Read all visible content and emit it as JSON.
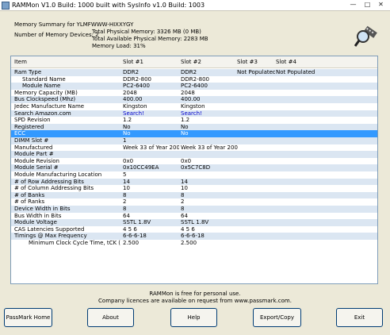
{
  "window": {
    "title": "RAMMon V1.0 Build: 1000 built with SysInfo v1.0 Build: 1003"
  },
  "summary": {
    "title": "Memory Summary for YLMFWWW-HIXXYGY",
    "devices": "Number of Memory Devices: 2",
    "total_physical": "Total Physical Memory: 3326 MB (0 MB)",
    "available_physical": "Total Available Physical Memory: 2283 MB",
    "memory_load": "Memory Load: 31%"
  },
  "table": {
    "headers": [
      "Item",
      "Slot #1",
      "Slot #2",
      "Slot #3",
      "Slot #4"
    ],
    "rows": [
      {
        "item": "Ram Type",
        "s1": "DDR2",
        "s2": "DDR2",
        "s3": "Not Populated",
        "s4": "Not Populated"
      },
      {
        "item": "Standard Name",
        "s1": "DDR2-800",
        "s2": "DDR2-800",
        "s3": "",
        "s4": ""
      },
      {
        "item": "Module Name",
        "s1": "PC2-6400",
        "s2": "PC2-6400",
        "s3": "",
        "s4": ""
      },
      {
        "item": "Memory Capacity (MB)",
        "s1": "2048",
        "s2": "2048",
        "s3": "",
        "s4": ""
      },
      {
        "item": "Bus Clockspeed (Mhz)",
        "s1": "400.00",
        "s2": "400.00",
        "s3": "",
        "s4": ""
      },
      {
        "item": "Jedec Manufacture Name",
        "s1": "Kingston",
        "s2": "Kingston",
        "s3": "",
        "s4": ""
      },
      {
        "item": "Search Amazon.com",
        "s1": "Search!",
        "s2": "Search!",
        "s3": "",
        "s4": ""
      },
      {
        "item": "SPD Revision",
        "s1": "1.2",
        "s2": "1.2",
        "s3": "",
        "s4": ""
      },
      {
        "item": "Registered",
        "s1": "No",
        "s2": "No",
        "s3": "",
        "s4": ""
      },
      {
        "item": "ECC",
        "s1": "No",
        "s2": "No",
        "s3": "",
        "s4": ""
      },
      {
        "item": "DIMM Slot #",
        "s1": "1",
        "s2": "",
        "s3": "",
        "s4": ""
      },
      {
        "item": "Manufactured",
        "s1": "Week 33 of Year 2008",
        "s2": "Week 33 of Year 2008",
        "s3": "",
        "s4": ""
      },
      {
        "item": "Module Part #",
        "s1": "",
        "s2": "",
        "s3": "",
        "s4": ""
      },
      {
        "item": "Module Revision",
        "s1": "0x0",
        "s2": "0x0",
        "s3": "",
        "s4": ""
      },
      {
        "item": "Module Serial #",
        "s1": "0x10CC49EA",
        "s2": "0x5C7C8D",
        "s3": "",
        "s4": ""
      },
      {
        "item": "Module Manufacturing Location",
        "s1": "5",
        "s2": "",
        "s3": "",
        "s4": ""
      },
      {
        "item": "# of Row Addressing Bits",
        "s1": "14",
        "s2": "14",
        "s3": "",
        "s4": ""
      },
      {
        "item": "# of Column Addressing Bits",
        "s1": "10",
        "s2": "10",
        "s3": "",
        "s4": ""
      },
      {
        "item": "# of Banks",
        "s1": "8",
        "s2": "8",
        "s3": "",
        "s4": ""
      },
      {
        "item": "# of Ranks",
        "s1": "2",
        "s2": "2",
        "s3": "",
        "s4": ""
      },
      {
        "item": "Device Width in Bits",
        "s1": "8",
        "s2": "8",
        "s3": "",
        "s4": ""
      },
      {
        "item": "Bus Width in Bits",
        "s1": "64",
        "s2": "64",
        "s3": "",
        "s4": ""
      },
      {
        "item": "Module Voltage",
        "s1": "SSTL 1.8V",
        "s2": "SSTL 1.8V",
        "s3": "",
        "s4": ""
      },
      {
        "item": "CAS Latencies Supported",
        "s1": "4 5 6",
        "s2": "4 5 6",
        "s3": "",
        "s4": ""
      },
      {
        "item": "Timings @ Max Frequency",
        "s1": "6-6-6-18",
        "s2": "6-6-6-18",
        "s3": "",
        "s4": ""
      },
      {
        "item": "Minimum Clock Cycle Time, tCK (ns)",
        "s1": "2.500",
        "s2": "2.500",
        "s3": "",
        "s4": ""
      }
    ]
  },
  "footer": {
    "line1": "RAMMon is free for personal use.",
    "line2": "Company licences are available on request from www.passmark.com."
  },
  "buttons": {
    "home": "PassMark Home",
    "about": "About",
    "help": "Help",
    "export": "Export/Copy",
    "exit": "Exit"
  },
  "colors": {
    "selection": "#3399ff",
    "alt_row": "#dbe6f2",
    "link": "#0000cc"
  }
}
